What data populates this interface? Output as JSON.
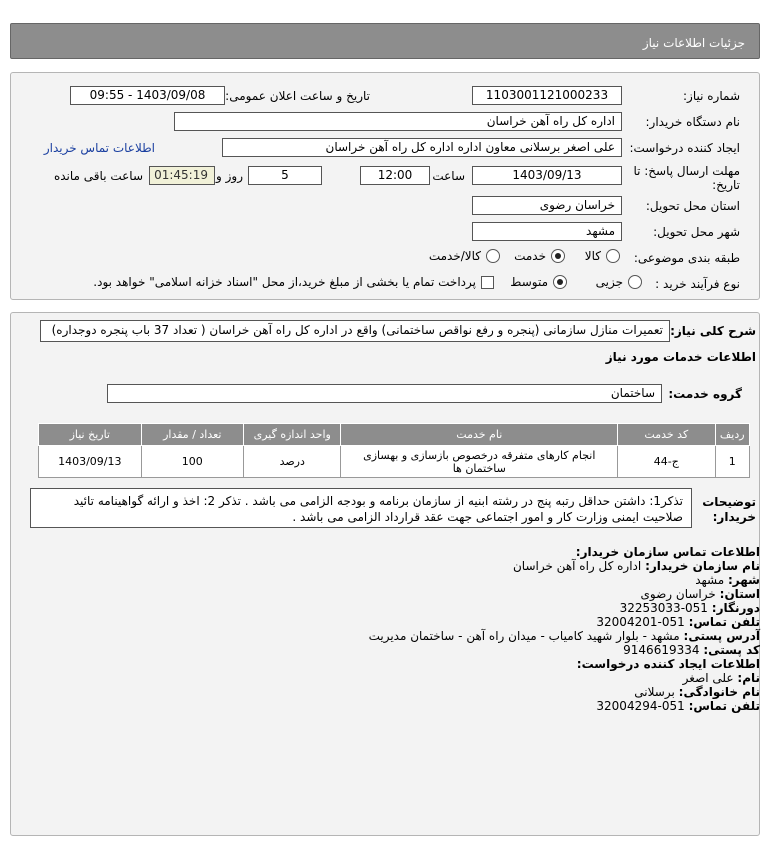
{
  "header": {
    "title": "جزئیات اطلاعات نیاز"
  },
  "form": {
    "need_number_label": "شماره نیاز:",
    "need_number": "1103001121000233",
    "announce_label": "تاریخ و ساعت اعلان عمومی:",
    "announce_value": "1403/09/08 - 09:55",
    "buyer_org_label": "نام دستگاه خریدار:",
    "buyer_org": "اداره کل راه آهن خراسان",
    "requester_label": "ایجاد کننده درخواست:",
    "requester": "علی اصغر برسلانی معاون اداره اداره کل راه آهن خراسان",
    "buyer_contact_link": "اطلاعات تماس خریدار",
    "deadline_label_line1": "مهلت ارسال پاسخ: تا",
    "deadline_label_line2": "تاریخ:",
    "deadline_date": "1403/09/13",
    "time_label": "ساعت",
    "deadline_time": "12:00",
    "days_value": "5",
    "days_label": "روز و",
    "remaining_time": "01:45:19",
    "remaining_label": "ساعت باقی مانده",
    "province_label": "استان محل تحویل:",
    "province": "خراسان رضوی",
    "city_label": "شهر محل تحویل:",
    "city": "مشهد",
    "category_label": "طبقه بندی موضوعی:",
    "category_options": [
      "کالا",
      "خدمت",
      "کالا/خدمت"
    ],
    "process_label": "نوع فرآیند خرید :",
    "process_options": [
      "جزیی",
      "متوسط"
    ],
    "payment_text": "پرداخت تمام یا بخشی از مبلغ خرید،از محل \"اسناد خزانه اسلامی\" خواهد بود."
  },
  "description": {
    "label": "شرح کلی نیاز:",
    "text": "تعمیرات منازل سازمانی (پنجره و رفع نواقص ساختمانی) واقع در اداره کل راه آهن خراسان ( تعداد 37 باب پنجره دوجداره)"
  },
  "services": {
    "section_title": "اطلاعات خدمات مورد نیاز",
    "group_label": "گروه خدمت:",
    "group_value": "ساختمان",
    "table_headers": [
      "ردیف",
      "کد خدمت",
      "نام خدمت",
      "واحد اندازه گیری",
      "تعداد / مقدار",
      "تاریخ نیاز"
    ],
    "rows": [
      {
        "row": "1",
        "code": "ج-44",
        "name": "انجام کارهای متفرقه درخصوص بازسازی و بهسازی ساختمان ها",
        "unit": "درصد",
        "qty": "100",
        "date": "1403/09/13"
      }
    ]
  },
  "notes": {
    "label_line1": "توضیحات",
    "label_line2": "خریدار:",
    "text": "تذکر1: داشتن حداقل رتبه پنج در رشته ابنیه از سازمان برنامه و بودجه الزامی می باشد . تذکر 2: اخذ و ارائه گواهینامه تائید صلاحیت ایمنی وزارت کار و امور اجتماعی جهت عقد قرارداد الزامی می باشد ."
  },
  "contact": {
    "title": "اطلاعات تماس سازمان خریدار:",
    "org_label": "نام سازمان خریدار:",
    "org": "اداره کل راه آهن خراسان",
    "city_label": "شهر:",
    "city": "مشهد",
    "province_label": "استان:",
    "province": "خراسان رضوی",
    "fax_label": "دورنگار:",
    "fax": "051-32253033",
    "phone_label": "تلفن تماس:",
    "phone": "051-32004201",
    "address_label": "آدرس پستی:",
    "address": "مشهد - بلوار شهید کامیاب - میدان راه آهن - ساختمان مدیریت",
    "postal_label": "کد پستی:",
    "postal": "9146619334",
    "creator_title": "اطلاعات ایجاد کننده درخواست:",
    "first_name_label": "نام:",
    "first_name": "علی اصغر",
    "last_name_label": "نام خانوادگی:",
    "last_name": "برسلانی",
    "creator_phone_label": "تلفن تماس:",
    "creator_phone": "051-32004294"
  }
}
